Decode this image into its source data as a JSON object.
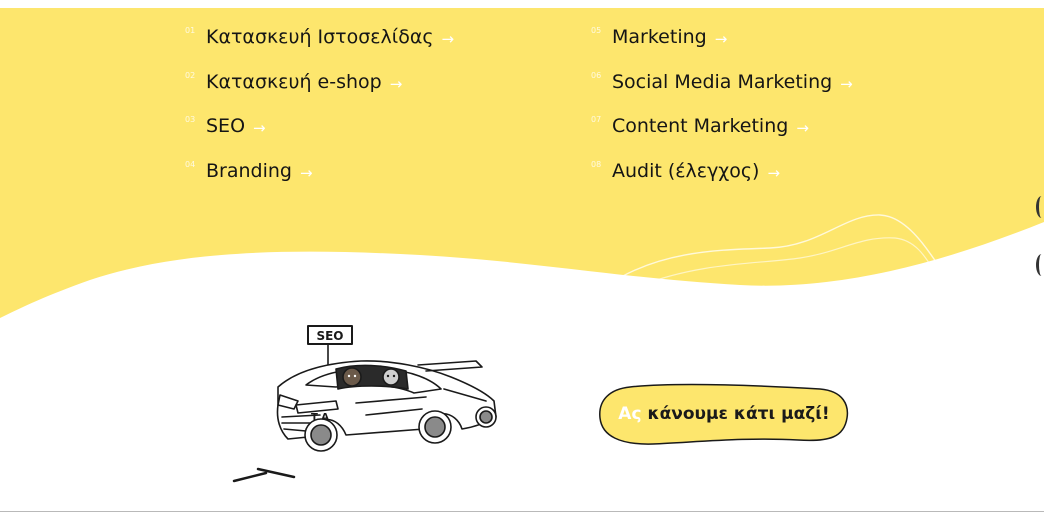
{
  "menu": {
    "left": [
      {
        "num": "01",
        "label": "Κατασκευή Ιστοσελίδας",
        "arrow": "→"
      },
      {
        "num": "02",
        "label": "Κατασκευή e-shop",
        "arrow": "→"
      },
      {
        "num": "03",
        "label": "SEO",
        "arrow": "→"
      },
      {
        "num": "04",
        "label": "Branding",
        "arrow": "→"
      }
    ],
    "right": [
      {
        "num": "05",
        "label": "Marketing",
        "arrow": "→"
      },
      {
        "num": "06",
        "label": "Social Media Marketing",
        "arrow": "→"
      },
      {
        "num": "07",
        "label": "Content Marketing",
        "arrow": "→"
      },
      {
        "num": "08",
        "label": "Audit (έλεγχος)",
        "arrow": "→"
      }
    ]
  },
  "illustration": {
    "sign_text": "SEO",
    "plate_text": "T A"
  },
  "cta": {
    "accent": "Ας",
    "text": "κάνουμε κάτι μαζί!"
  },
  "colors": {
    "brand_yellow": "#fde66d",
    "text_dark": "#151515",
    "accent_white": "#ffffff"
  }
}
